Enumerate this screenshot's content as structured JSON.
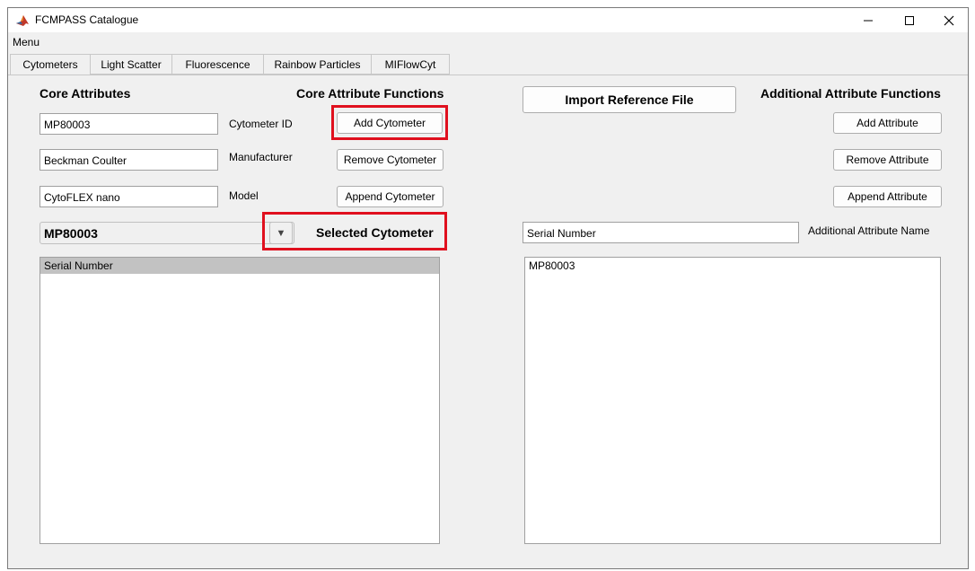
{
  "window": {
    "title": "FCMPASS Catalogue"
  },
  "menu": {
    "label": "Menu"
  },
  "tabs": [
    {
      "label": "Cytometers"
    },
    {
      "label": "Light Scatter"
    },
    {
      "label": "Fluorescence"
    },
    {
      "label": "Rainbow Particles"
    },
    {
      "label": "MIFlowCyt"
    }
  ],
  "core": {
    "heading": "Core Attributes",
    "functions_heading": "Core Attribute Functions",
    "cytometer_id_value": "MP80003",
    "cytometer_id_label": "Cytometer ID",
    "manufacturer_value": "Beckman Coulter",
    "manufacturer_label": "Manufacturer",
    "model_value": "CytoFLEX nano",
    "model_label": "Model",
    "add_button": "Add Cytometer",
    "remove_button": "Remove Cytometer",
    "append_button": "Append Cytometer",
    "selected_value": "MP80003",
    "selected_label": "Selected Cytometer",
    "list_items": [
      "Serial Number"
    ]
  },
  "additional": {
    "import_button": "Import Reference File",
    "functions_heading": "Additional Attribute Functions",
    "add_button": "Add Attribute",
    "remove_button": "Remove Attribute",
    "append_button": "Append Attribute",
    "name_value": "Serial Number",
    "name_label": "Additional Attribute Name",
    "value_text": "MP80003"
  },
  "colors": {
    "highlight": "#e0101e",
    "selected_row": "#c2c2c2",
    "background": "#f0f0f0"
  }
}
